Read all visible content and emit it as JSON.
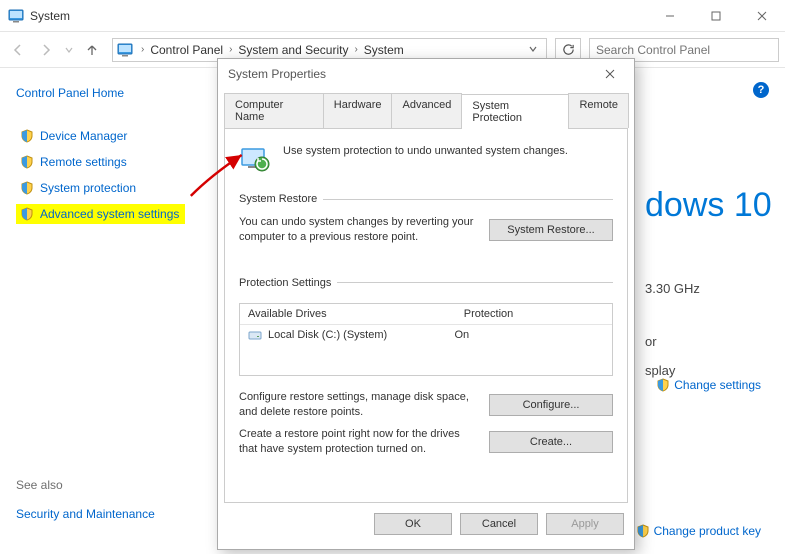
{
  "window": {
    "title": "System"
  },
  "breadcrumb": {
    "items": [
      "Control Panel",
      "System and Security",
      "System"
    ]
  },
  "search": {
    "placeholder": "Search Control Panel"
  },
  "leftnav": {
    "home": "Control Panel Home",
    "items": [
      {
        "label": "Device Manager"
      },
      {
        "label": "Remote settings"
      },
      {
        "label": "System protection"
      },
      {
        "label": "Advanced system settings"
      }
    ],
    "seealso_label": "See also",
    "seealso_item": "Security and Maintenance"
  },
  "rightpane": {
    "edition_partial": "dows 10",
    "spec_cpu_partial": "3.30 GHz",
    "spec_line2_partial": "or",
    "spec_line3_partial": "splay",
    "link_change_settings": "Change settings",
    "link_change_key": "Change product key"
  },
  "dialog": {
    "title": "System Properties",
    "tabs": {
      "computer_name": "Computer Name",
      "hardware": "Hardware",
      "advanced": "Advanced",
      "system_protection": "System Protection",
      "remote": "Remote"
    },
    "intro": "Use system protection to undo unwanted system changes.",
    "restore": {
      "legend": "System Restore",
      "desc": "You can undo system changes by reverting your computer to a previous restore point.",
      "button": "System Restore..."
    },
    "protection": {
      "legend": "Protection Settings",
      "col_drives": "Available Drives",
      "col_protection": "Protection",
      "drive_label": "Local Disk (C:) (System)",
      "drive_status": "On",
      "configure_desc": "Configure restore settings, manage disk space, and delete restore points.",
      "configure_btn": "Configure...",
      "create_desc": "Create a restore point right now for the drives that have system protection turned on.",
      "create_btn": "Create..."
    },
    "footer": {
      "ok": "OK",
      "cancel": "Cancel",
      "apply": "Apply"
    }
  }
}
